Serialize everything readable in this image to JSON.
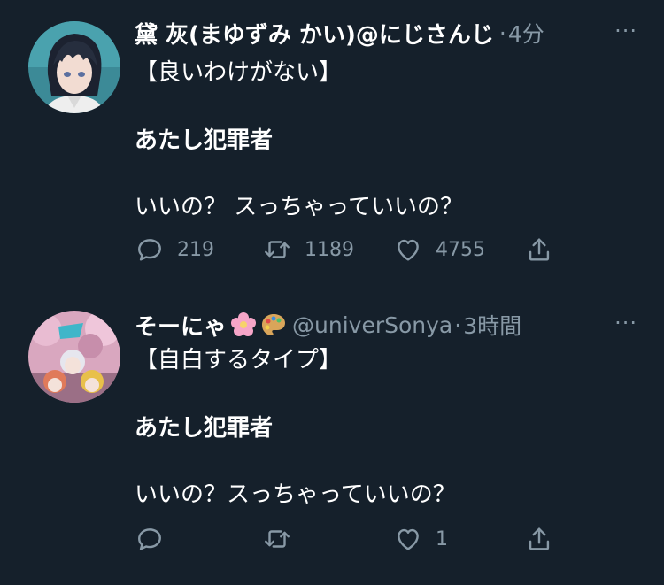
{
  "tweets": [
    {
      "display_name": "黛 灰(まゆずみ かい)@にじさんじ",
      "handle": "",
      "dot": "·",
      "time": "4分",
      "more": "···",
      "lines": [
        "【良いわけがない】",
        "あたし犯罪者",
        "いいの？ スっちゃっていいの？"
      ],
      "reply_count": "219",
      "retweet_count": "1189",
      "like_count": "4755"
    },
    {
      "display_name": "そーにゃ",
      "handle": "@univerSonya",
      "dot": "·",
      "time": "3時間",
      "more": "···",
      "lines": [
        "【自白するタイプ】",
        "あたし犯罪者",
        "いいの？スっちゃっていいの？"
      ],
      "reply_count": "",
      "retweet_count": "",
      "like_count": "1"
    }
  ],
  "icons": {
    "reply": "reply-icon",
    "retweet": "retweet-icon",
    "like": "heart-icon",
    "share": "share-icon",
    "emoji_1": "cherry-blossom-icon",
    "emoji_2": "palette-icon"
  },
  "colors": {
    "background": "#15202b",
    "secondary_text": "#8899a6",
    "divider": "#38444d"
  }
}
